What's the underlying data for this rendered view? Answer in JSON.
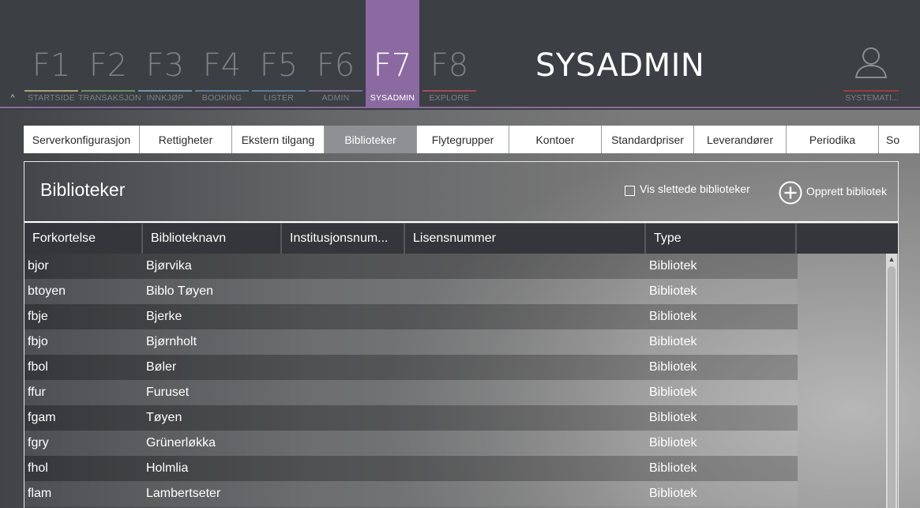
{
  "nav": {
    "collapse_glyph": "^",
    "fkeys": [
      {
        "key": "F1",
        "label": "STARTSIDE",
        "accent": "#a7a27a"
      },
      {
        "key": "F2",
        "label": "TRANSAKSJON",
        "accent": "#6d8f63"
      },
      {
        "key": "F3",
        "label": "INNKJØP",
        "accent": "#7a8fa7"
      },
      {
        "key": "F4",
        "label": "BOOKING",
        "accent": "#5e7e98"
      },
      {
        "key": "F5",
        "label": "LISTER",
        "accent": "#5a7e9a"
      },
      {
        "key": "F6",
        "label": "ADMIN",
        "accent": "#7a6c92"
      },
      {
        "key": "F7",
        "label": "SYSADMIN",
        "accent": "#8b6aa1"
      },
      {
        "key": "F8",
        "label": "EXPLORE",
        "accent": "#a44a5a"
      }
    ],
    "active": "F7",
    "module_title": "SYSADMIN",
    "user_label": "SYSTEMATI..."
  },
  "tabs": [
    {
      "label": "Serverkonfigurasjon"
    },
    {
      "label": "Rettigheter"
    },
    {
      "label": "Ekstern tilgang"
    },
    {
      "label": "Biblioteker"
    },
    {
      "label": "Flytegrupper"
    },
    {
      "label": "Kontoer"
    },
    {
      "label": "Standardpriser"
    },
    {
      "label": "Leverandører"
    },
    {
      "label": "Periodika"
    },
    {
      "label": "So"
    }
  ],
  "active_tab": "Biblioteker",
  "panel": {
    "title": "Biblioteker",
    "show_deleted_label": "Vis slettede biblioteker",
    "show_deleted_checked": false,
    "create_label": "Opprett bibliotek"
  },
  "table": {
    "columns": [
      "Forkortelse",
      "Biblioteknavn",
      "Institusjonsnum...",
      "Lisensnummer",
      "Type",
      ""
    ],
    "rows": [
      [
        "bjor",
        "Bjørvika",
        "",
        "",
        "Bibliotek"
      ],
      [
        "btoyen",
        "Biblo Tøyen",
        "",
        "",
        "Bibliotek"
      ],
      [
        "fbje",
        "Bjerke",
        "",
        "",
        "Bibliotek"
      ],
      [
        "fbjo",
        "Bjørnholt",
        "",
        "",
        "Bibliotek"
      ],
      [
        "fbol",
        "Bøler",
        "",
        "",
        "Bibliotek"
      ],
      [
        "ffur",
        "Furuset",
        "",
        "",
        "Bibliotek"
      ],
      [
        "fgam",
        "Tøyen",
        "",
        "",
        "Bibliotek"
      ],
      [
        "fgry",
        "Grünerløkka",
        "",
        "",
        "Bibliotek"
      ],
      [
        "fhol",
        "Holmlia",
        "",
        "",
        "Bibliotek"
      ],
      [
        "flam",
        "Lambertseter",
        "",
        "",
        "Bibliotek"
      ]
    ]
  },
  "colors": {
    "accent": "#8b6aa1",
    "active_tab_bg": "#8f9094",
    "header_bg": "#3c3f44"
  }
}
